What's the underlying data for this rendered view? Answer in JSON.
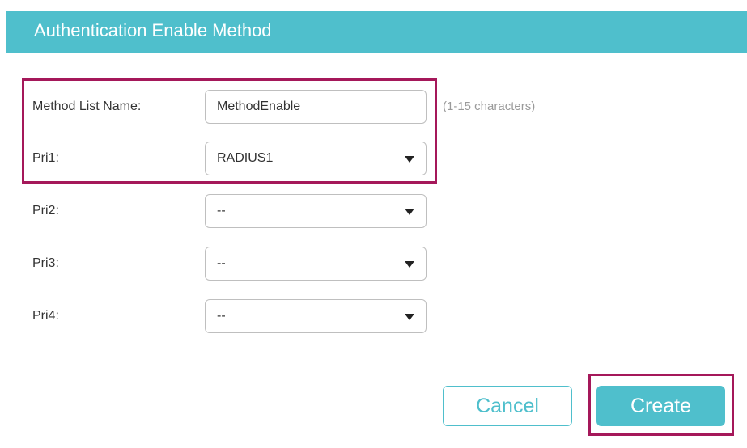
{
  "dialog": {
    "title": "Authentication Enable Method"
  },
  "form": {
    "method_list_name": {
      "label": "Method List Name:",
      "value": "MethodEnable",
      "hint": "(1-15 characters)"
    },
    "pri1": {
      "label": "Pri1:",
      "value": "RADIUS1"
    },
    "pri2": {
      "label": "Pri2:",
      "value": "--"
    },
    "pri3": {
      "label": "Pri3:",
      "value": "--"
    },
    "pri4": {
      "label": "Pri4:",
      "value": "--"
    }
  },
  "buttons": {
    "cancel_label": "Cancel",
    "create_label": "Create"
  },
  "colors": {
    "accent": "#4fbfcc",
    "highlight": "#a5185a"
  },
  "icons": {
    "dropdown": "caret-down-icon"
  }
}
